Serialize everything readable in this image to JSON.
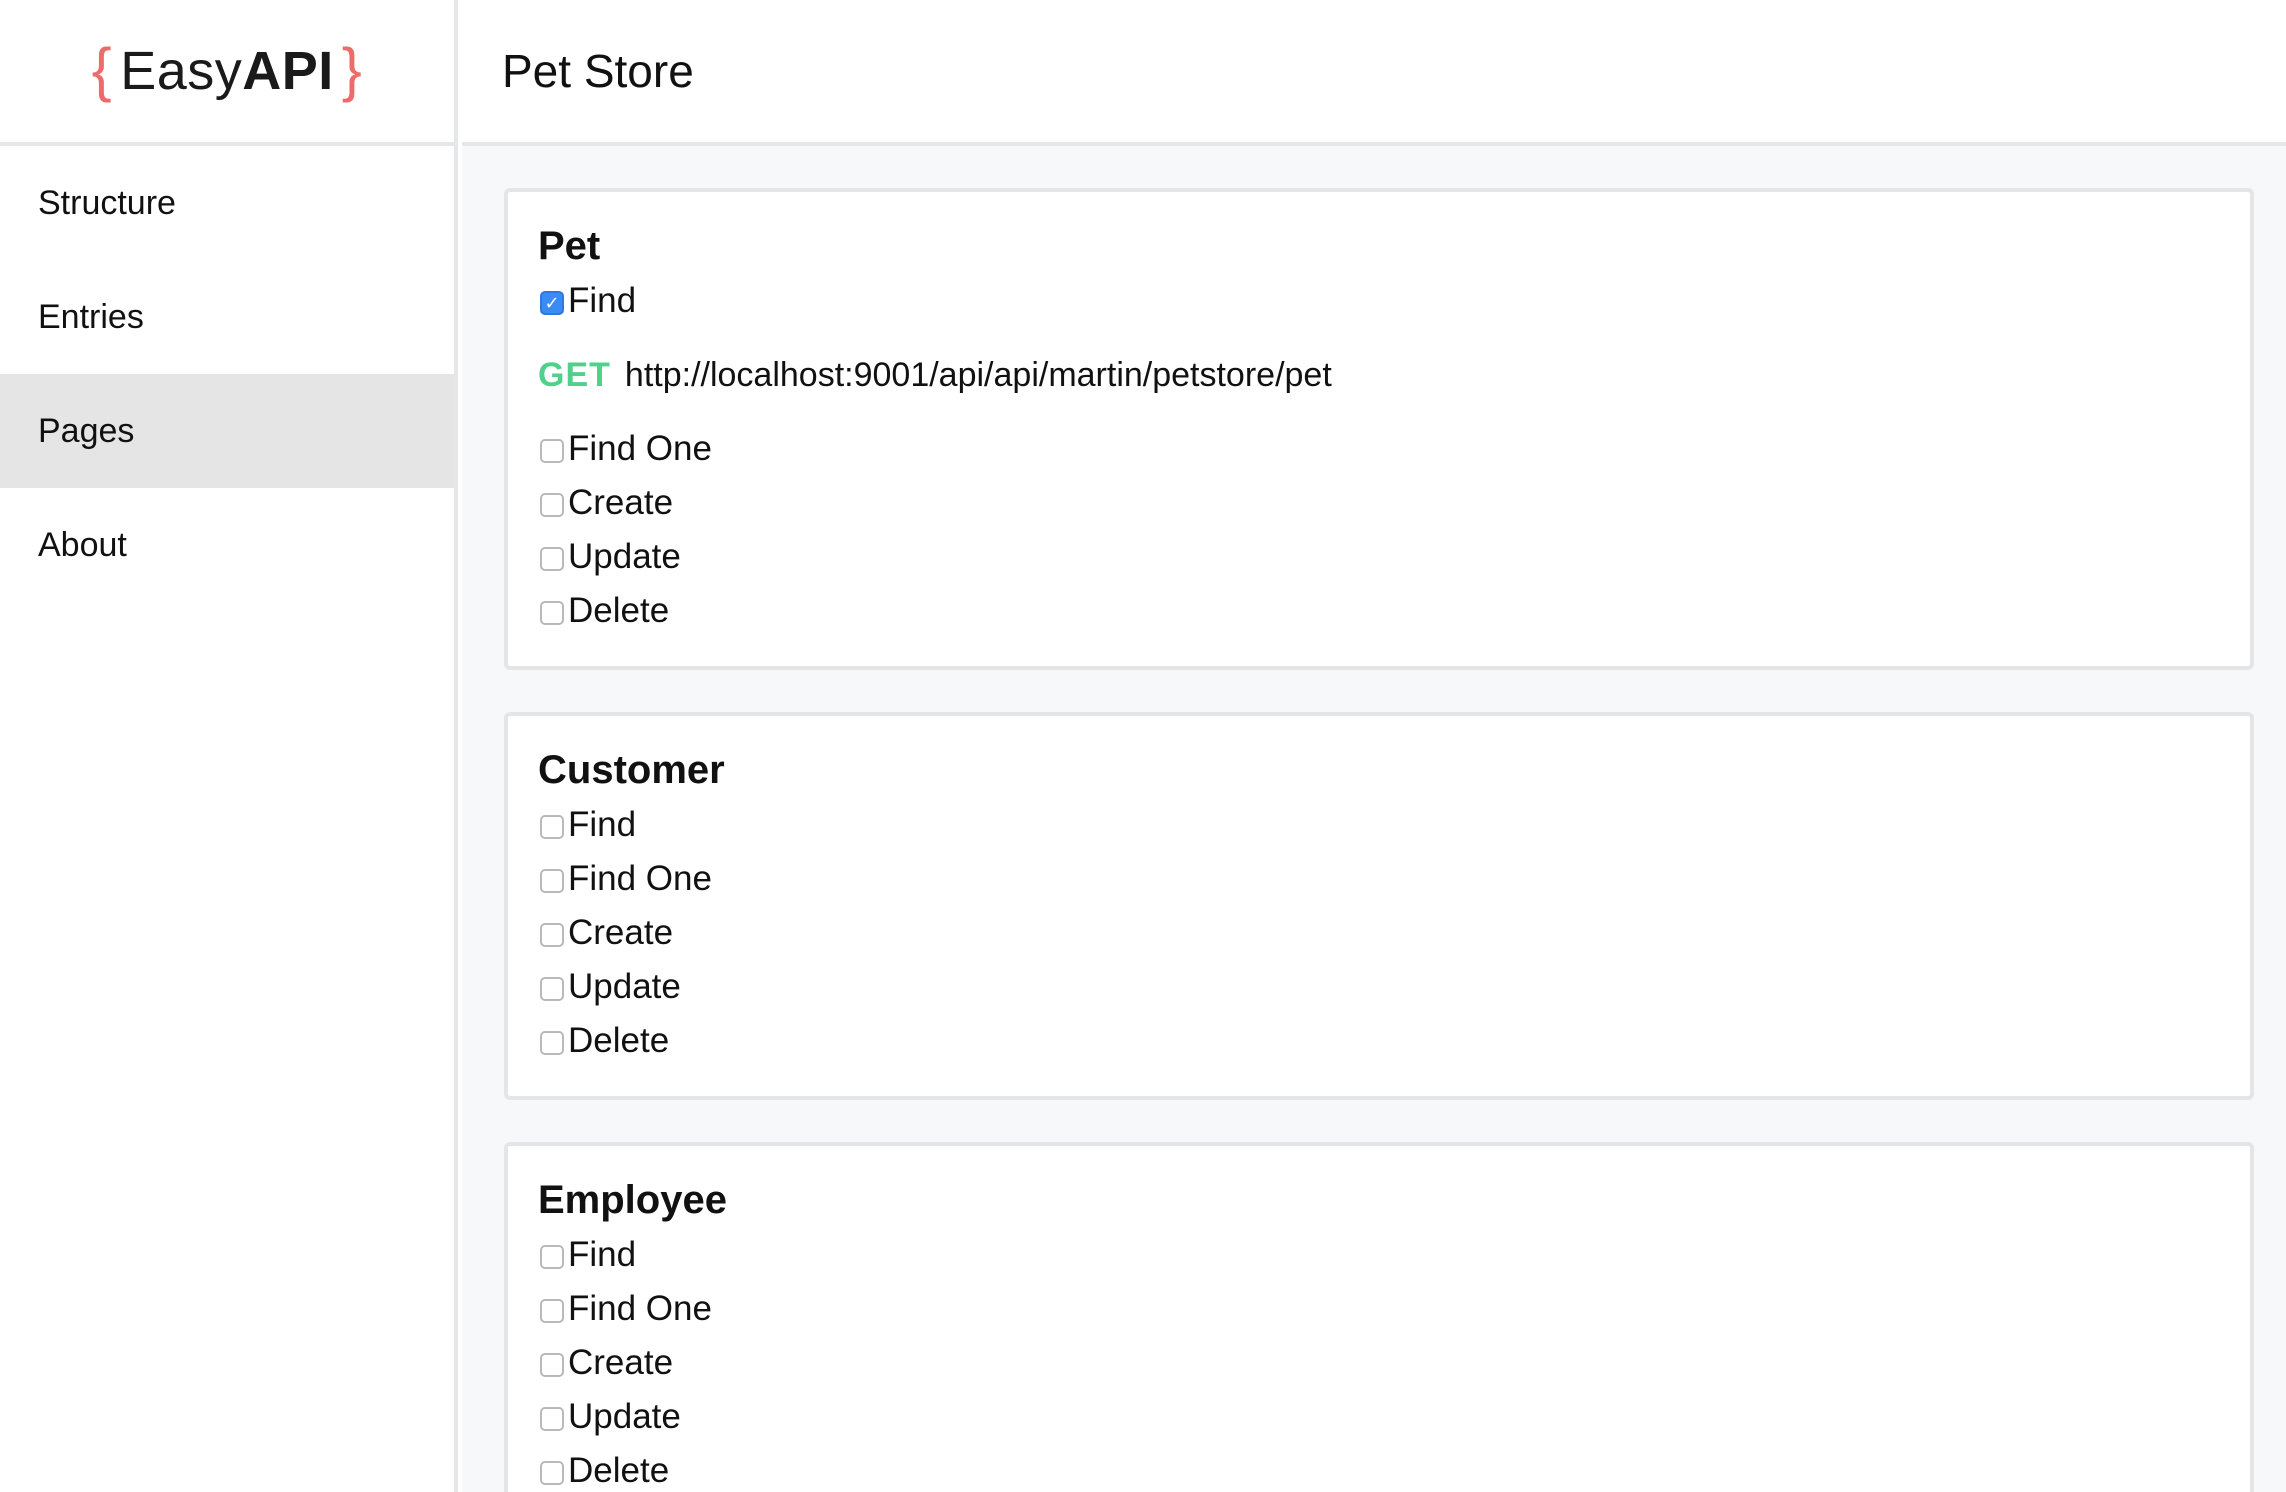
{
  "logo": {
    "brace_open": "{",
    "easy": "Easy",
    "api": "API",
    "brace_close": "}"
  },
  "sidebar": {
    "items": [
      {
        "label": "Structure"
      },
      {
        "label": "Entries"
      },
      {
        "label": "Pages",
        "active": true
      },
      {
        "label": "About"
      }
    ]
  },
  "header": {
    "title": "Pet Store"
  },
  "cards": [
    {
      "title": "Pet",
      "ops": [
        {
          "label": "Find",
          "checked": true
        },
        {
          "label": "Find One",
          "checked": false
        },
        {
          "label": "Create",
          "checked": false
        },
        {
          "label": "Update",
          "checked": false
        },
        {
          "label": "Delete",
          "checked": false
        }
      ],
      "endpoint": {
        "method": "GET",
        "url": "http://localhost:9001/api/api/martin/petstore/pet"
      }
    },
    {
      "title": "Customer",
      "ops": [
        {
          "label": "Find",
          "checked": false
        },
        {
          "label": "Find One",
          "checked": false
        },
        {
          "label": "Create",
          "checked": false
        },
        {
          "label": "Update",
          "checked": false
        },
        {
          "label": "Delete",
          "checked": false
        }
      ]
    },
    {
      "title": "Employee",
      "ops": [
        {
          "label": "Find",
          "checked": false
        },
        {
          "label": "Find One",
          "checked": false
        },
        {
          "label": "Create",
          "checked": false
        },
        {
          "label": "Update",
          "checked": false
        },
        {
          "label": "Delete",
          "checked": false
        }
      ]
    }
  ],
  "colors": {
    "brace": "#ee6b6b",
    "method_get": "#4fd18b",
    "checkbox_checked": "#3b8bf6",
    "nav_active": "#e5e5e5"
  }
}
